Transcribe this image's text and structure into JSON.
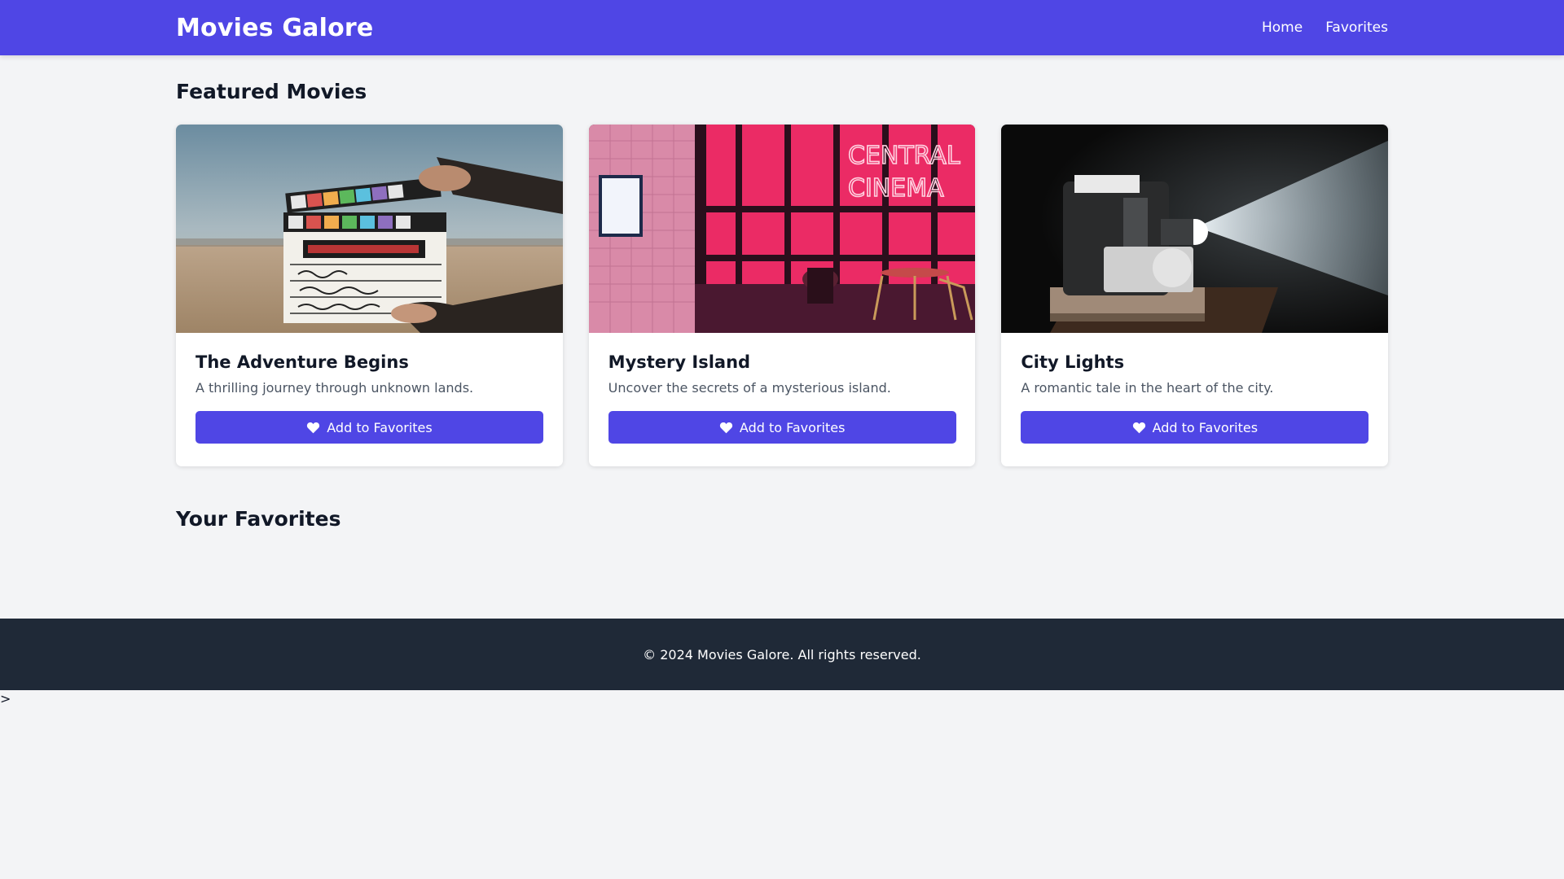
{
  "header": {
    "brand": "Movies Galore",
    "nav": [
      {
        "label": "Home"
      },
      {
        "label": "Favorites"
      }
    ]
  },
  "featured": {
    "title": "Featured Movies",
    "cards": [
      {
        "title": "The Adventure Begins",
        "description": "A thrilling journey through unknown lands.",
        "button_label": "Add to Favorites",
        "image_alt": "clapperboard in desert"
      },
      {
        "title": "Mystery Island",
        "description": "Uncover the secrets of a mysterious island.",
        "button_label": "Add to Favorites",
        "image_alt": "neon cinema entrance"
      },
      {
        "title": "City Lights",
        "description": "A romantic tale in the heart of the city.",
        "button_label": "Add to Favorites",
        "image_alt": "film projector beam"
      }
    ]
  },
  "favorites": {
    "title": "Your Favorites"
  },
  "footer": {
    "text": "© 2024 Movies Galore. All rights reserved."
  },
  "stray_text": ">",
  "colors": {
    "primary": "#4f46e5",
    "footer_bg": "#1f2937",
    "page_bg": "#f3f4f6"
  },
  "icons": {
    "button": "heart-icon"
  }
}
